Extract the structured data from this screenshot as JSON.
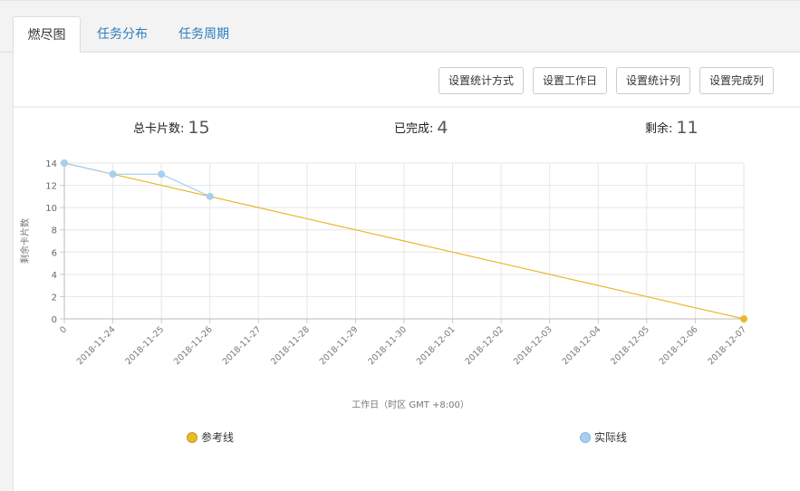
{
  "tabs": [
    {
      "label": "燃尽图",
      "active": true
    },
    {
      "label": "任务分布",
      "active": false
    },
    {
      "label": "任务周期",
      "active": false
    }
  ],
  "toolbar": {
    "buttons": [
      "设置统计方式",
      "设置工作日",
      "设置统计列",
      "设置完成列"
    ]
  },
  "stats": {
    "total_label": "总卡片数:",
    "total_value": "15",
    "done_label": "已完成:",
    "done_value": "4",
    "remaining_label": "剩余:",
    "remaining_value": "11"
  },
  "colors": {
    "reference": "#e8b92f",
    "actual": "#a9cfee",
    "actual_point": "#a9cfee",
    "reference_point": "#e8b92f",
    "link": "#2e7dbd"
  },
  "chart_data": {
    "type": "line",
    "categories": [
      "0",
      "2018-11-24",
      "2018-11-25",
      "2018-11-26",
      "2018-11-27",
      "2018-11-28",
      "2018-11-29",
      "2018-11-30",
      "2018-12-01",
      "2018-12-02",
      "2018-12-03",
      "2018-12-04",
      "2018-12-05",
      "2018-12-06",
      "2018-12-07"
    ],
    "series": [
      {
        "name": "参考线",
        "values": [
          14,
          13,
          12,
          11,
          10,
          9,
          8,
          7,
          6,
          5,
          4,
          3,
          2,
          1,
          0
        ]
      },
      {
        "name": "实际线",
        "values": [
          14,
          13,
          13,
          11,
          null,
          null,
          null,
          null,
          null,
          null,
          null,
          null,
          null,
          null,
          null
        ]
      }
    ],
    "xlabel": "工作日（时区 GMT +8:00）",
    "ylabel": "剩余卡片数",
    "ylim": [
      0,
      14
    ],
    "yticks": [
      0,
      2,
      4,
      6,
      8,
      10,
      12,
      14
    ],
    "grid": true,
    "legend_position": "bottom"
  }
}
